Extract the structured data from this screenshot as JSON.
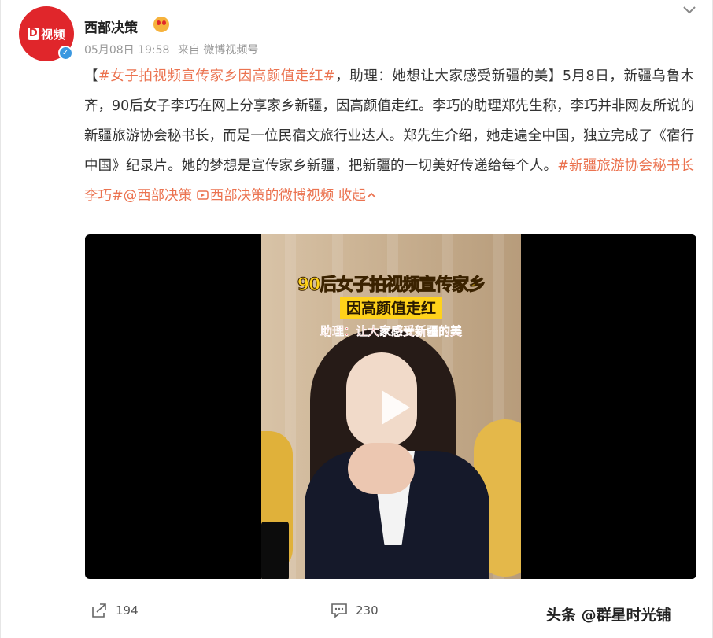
{
  "header": {
    "avatar_text": "视频",
    "user_name": "西部决策",
    "date": "05月08日 19:58",
    "source": "来自 微博视频号"
  },
  "post": {
    "bracket_open": "【",
    "topic": "#女子拍视频宣传家乡因高颜值走红#",
    "headline_rest": "，助理：她想让大家感受新疆的美】",
    "body": "5月8日，新疆乌鲁木齐，90后女子李巧在网上分享家乡新疆，因高颜值走红。李巧的助理郑先生称，李巧并非网友所说的新疆旅游协会秘书长，而是一位民宿文旅行业达人。郑先生介绍，她走遍全中国，独立完成了《宿行中国》纪录片。她的梦想是宣传家乡新疆，把新疆的一切美好传递给每个人。",
    "tag2": "#新疆旅游协会秘书长李巧#",
    "mention": "@西部决策",
    "video_link": "西部决策的微博视频",
    "collapse_label": "收起"
  },
  "video": {
    "caption_line1": "90后女子拍视频宣传家乡",
    "caption_line2": "因高颜值走红",
    "caption_line3": "助理：让大家感受新疆的美"
  },
  "footer": {
    "share_count": "194",
    "comment_count": "230",
    "watermark": "头条 @群星时光铺"
  },
  "colors": {
    "accent": "#eb7350",
    "avatar_bg": "#e0262b",
    "verified": "#3b98e0"
  }
}
